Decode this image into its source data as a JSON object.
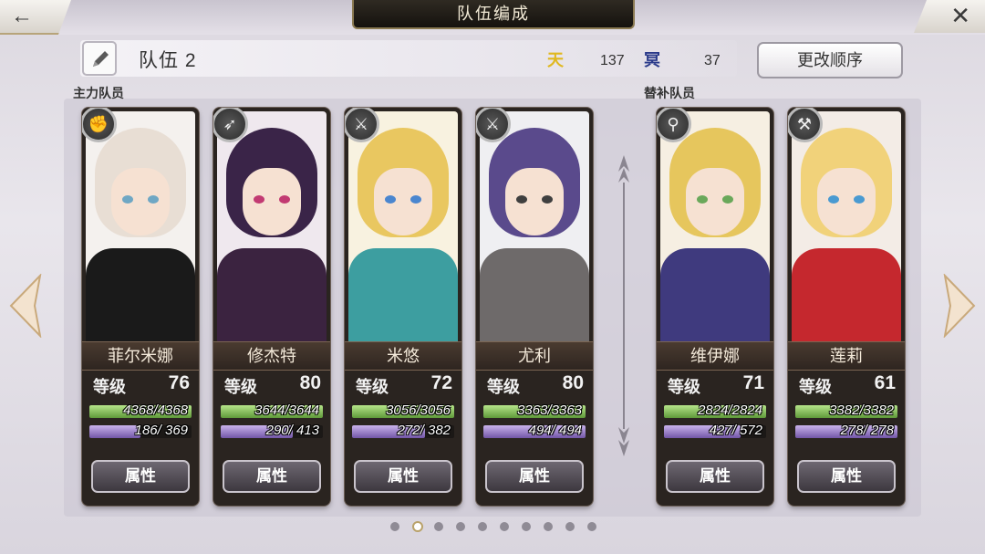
{
  "header": {
    "title": "队伍编成",
    "back_label": "←",
    "close_label": "✕"
  },
  "team": {
    "name": "队伍 2",
    "cost_a_icon": "天",
    "cost_a_value": "137",
    "cost_b_icon": "冥",
    "cost_b_value": "37",
    "order_button": "更改顺序"
  },
  "sections": {
    "main": "主力队员",
    "sub": "替补队员"
  },
  "level_label": "等级",
  "attr_label": "属性",
  "members": [
    {
      "name": "菲尔米娜",
      "level": "76",
      "hp": "4368/4368",
      "hp_frac": 1.0,
      "mp": "186/ 369",
      "mp_frac": 0.504,
      "weapon": "gauntlet-icon",
      "hair": "#e8ded4",
      "accent": "#1a1a1a",
      "bg": "#f4f1ee",
      "eye": "#6fa7c4"
    },
    {
      "name": "修杰特",
      "level": "80",
      "hp": "3644/3644",
      "hp_frac": 1.0,
      "mp": "290/ 413",
      "mp_frac": 0.702,
      "weapon": "spear-icon",
      "hair": "#3a2448",
      "accent": "#3b2340",
      "bg": "#efe8ee",
      "eye": "#c23a72"
    },
    {
      "name": "米悠",
      "level": "72",
      "hp": "3056/3056",
      "hp_frac": 1.0,
      "mp": "272/ 382",
      "mp_frac": 0.712,
      "weapon": "sword-icon",
      "hair": "#e9c760",
      "accent": "#3d9ea0",
      "bg": "#f8f2e0",
      "eye": "#4a86cf"
    },
    {
      "name": "尤利",
      "level": "80",
      "hp": "3363/3363",
      "hp_frac": 1.0,
      "mp": "494/ 494",
      "mp_frac": 1.0,
      "weapon": "katana-icon",
      "hair": "#5a4a8c",
      "accent": "#6e6a6a",
      "bg": "#efeff2",
      "eye": "#3f3f3f"
    },
    {
      "name": "维伊娜",
      "level": "71",
      "hp": "2824/2824",
      "hp_frac": 1.0,
      "mp": "427/ 572",
      "mp_frac": 0.747,
      "weapon": "staff-icon",
      "hair": "#e6c65d",
      "accent": "#3f3a7e",
      "bg": "#f6efe2",
      "eye": "#6aa85a"
    },
    {
      "name": "莲莉",
      "level": "61",
      "hp": "3382/3382",
      "hp_frac": 1.0,
      "mp": "278/ 278",
      "mp_frac": 1.0,
      "weapon": "axe-icon",
      "hair": "#f1d27a",
      "accent": "#c5282e",
      "bg": "#f3ece6",
      "eye": "#4a9ad1"
    }
  ],
  "pagination": {
    "count": 10,
    "active": 1
  }
}
